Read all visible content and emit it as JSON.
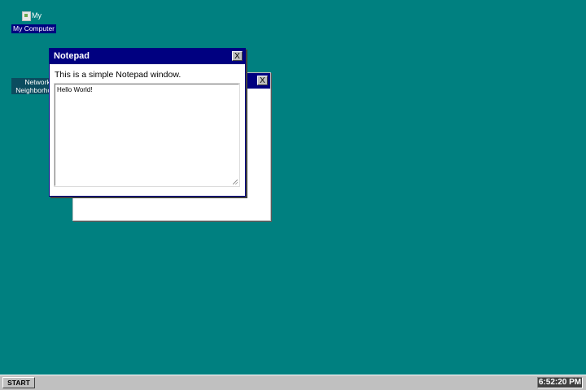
{
  "desktop": {
    "background_color": "#008080",
    "icons": [
      {
        "label": "My Computer",
        "image_alt": "My",
        "icon": "computer-icon"
      },
      {
        "label": "Network Neighborhood",
        "icon": "network-icon"
      }
    ]
  },
  "windows": {
    "back": {
      "close_label": "X"
    },
    "front": {
      "title": "Notepad",
      "close_label": "X",
      "description": "This is a simple Notepad window.",
      "textarea_value": "Hello World!"
    }
  },
  "taskbar": {
    "start_label": "START",
    "clock": "6:52:20 PM"
  },
  "colors": {
    "titlebar": "#000080",
    "taskbar": "#c0c0c0"
  }
}
